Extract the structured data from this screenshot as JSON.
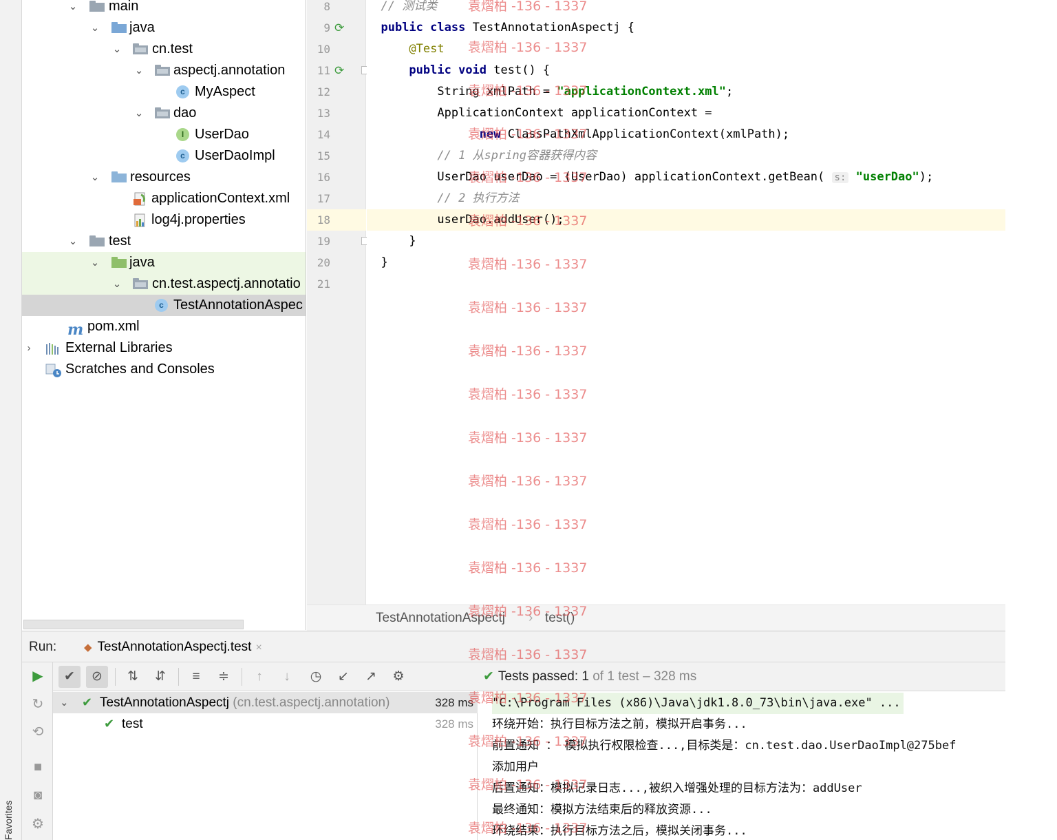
{
  "favorites": {
    "label": "Favorites"
  },
  "project_tree": [
    {
      "label": "main"
    },
    {
      "label": "java"
    },
    {
      "label": "cn.test"
    },
    {
      "label": "aspectj.annotation"
    },
    {
      "label": "MyAspect",
      "glyph": "c"
    },
    {
      "label": "dao"
    },
    {
      "label": "UserDao",
      "glyph": "I"
    },
    {
      "label": "UserDaoImpl",
      "glyph": "c"
    },
    {
      "label": "resources"
    },
    {
      "label": "applicationContext.xml"
    },
    {
      "label": "log4j.properties"
    },
    {
      "label": "test"
    },
    {
      "label": "java"
    },
    {
      "label": "cn.test.aspectj.annotatio"
    },
    {
      "label": "TestAnnotationAspec",
      "glyph": "c"
    },
    {
      "label": "pom.xml",
      "glyph": "m"
    },
    {
      "label": "External Libraries"
    },
    {
      "label": "Scratches and Consoles"
    }
  ],
  "editor": {
    "line_numbers": [
      "8",
      "9",
      "10",
      "11",
      "12",
      "13",
      "14",
      "15",
      "16",
      "17",
      "18",
      "19",
      "20",
      "21"
    ],
    "lines": [
      {
        "indent": "",
        "parts": [
          {
            "t": "// 测试类",
            "c": "cmt"
          }
        ]
      },
      {
        "indent": "",
        "parts": [
          {
            "t": "public ",
            "c": "kw"
          },
          {
            "t": "class ",
            "c": "kw"
          },
          {
            "t": "TestAnnotationAspectj {",
            "c": ""
          }
        ]
      },
      {
        "indent": "    ",
        "parts": [
          {
            "t": "@Test",
            "c": "ann"
          }
        ]
      },
      {
        "indent": "    ",
        "parts": [
          {
            "t": "public ",
            "c": "kw"
          },
          {
            "t": "void ",
            "c": "kw"
          },
          {
            "t": "test() {",
            "c": ""
          }
        ]
      },
      {
        "indent": "        ",
        "parts": [
          {
            "t": "String xmlPath = ",
            "c": ""
          },
          {
            "t": "\"applicationContext.xml\"",
            "c": "str"
          },
          {
            "t": ";",
            "c": ""
          }
        ]
      },
      {
        "indent": "        ",
        "parts": [
          {
            "t": "ApplicationContext applicationContext =",
            "c": ""
          }
        ]
      },
      {
        "indent": "              ",
        "parts": [
          {
            "t": "new ",
            "c": "kw"
          },
          {
            "t": "ClassPathXmlApplicationContext(xmlPath);",
            "c": ""
          }
        ]
      },
      {
        "indent": "        ",
        "parts": [
          {
            "t": "// 1 从spring容器获得内容",
            "c": "cmt"
          }
        ]
      },
      {
        "indent": "        ",
        "parts": [
          {
            "t": "UserDao userDao = (UserDao) applicationContext.getBean( ",
            "c": ""
          },
          {
            "t": "s:",
            "c": "hint"
          },
          {
            "t": " ",
            "c": ""
          },
          {
            "t": "\"userDao\"",
            "c": "str"
          },
          {
            "t": ");",
            "c": ""
          }
        ]
      },
      {
        "indent": "        ",
        "parts": [
          {
            "t": "// 2 执行方法",
            "c": "cmt"
          }
        ]
      },
      {
        "indent": "        ",
        "parts": [
          {
            "t": "userDao.addUser();",
            "c": ""
          }
        ]
      },
      {
        "indent": "    ",
        "parts": [
          {
            "t": "}",
            "c": ""
          }
        ]
      },
      {
        "indent": "",
        "parts": [
          {
            "t": "}",
            "c": ""
          }
        ]
      },
      {
        "indent": "",
        "parts": []
      }
    ]
  },
  "breadcrumb": {
    "class_name": "TestAnnotationAspectj",
    "separator": "›",
    "method": "test()"
  },
  "run": {
    "label": "Run:",
    "tab_label": "TestAnnotationAspectj.test",
    "tab_close": "×",
    "status_prefix": "Tests passed:",
    "status_count": "1",
    "status_rest": "of 1 test – 328 ms",
    "test_tree": [
      {
        "name": "TestAnnotationAspectj",
        "pkg": "(cn.test.aspectj.annotation)",
        "time": "328 ms"
      },
      {
        "name": "test",
        "pkg": "",
        "time": "328 ms"
      }
    ],
    "console": [
      "\"C:\\Program Files (x86)\\Java\\jdk1.8.0_73\\bin\\java.exe\" ...",
      "环绕开始：执行目标方法之前，模拟开启事务...",
      "前置通知 ： 模拟执行权限检查...,目标类是：cn.test.dao.UserDaoImpl@275bef",
      "添加用户",
      "后置通知：模拟记录日志...,被织入增强处理的目标方法为：addUser",
      "最终通知：模拟方法结束后的释放资源...",
      "环绕结束：执行目标方法之后，模拟关闭事务..."
    ]
  },
  "watermark": {
    "text": "袁熠柏 -136 - 1337"
  },
  "colors": {
    "keyword": "#000080",
    "string": "#008000",
    "comment": "#8c8c8c",
    "annotation": "#808000",
    "success": "#3d9b3d",
    "watermark": "#e14646"
  }
}
